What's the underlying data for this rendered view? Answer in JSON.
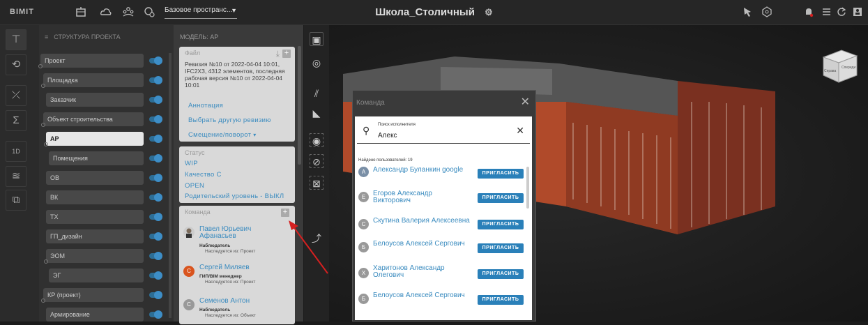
{
  "topbar": {
    "logo": "BIMIT",
    "icons": [
      "buildings-icon",
      "cloud-icon",
      "people-icon",
      "settings-gear-icon"
    ],
    "space_select": "Базовое пространс...",
    "project_title": "Школа_Столичный",
    "title_icon": "settings-gear-icon",
    "right_icons": [
      "cursor-icon",
      "rotate-icon",
      "bell-icon",
      "list-icon",
      "refresh-icon",
      "user-icon"
    ]
  },
  "toolstrip": {
    "tools": [
      "structure-tree-icon",
      "rotate-3d-icon",
      "merge-icon",
      "sum-icon",
      "cube-2d-icon",
      "layers-icon",
      "puzzle-icon"
    ]
  },
  "structure": {
    "header": "СТРУКТУРА ПРОЕКТА",
    "items": [
      {
        "label": "Проект"
      },
      {
        "label": "Площадка"
      },
      {
        "label": "Заказчик"
      },
      {
        "label": "Объект строительства"
      },
      {
        "label": "АР",
        "selected": true
      },
      {
        "label": "Помещения"
      },
      {
        "label": "ОВ"
      },
      {
        "label": "ВК"
      },
      {
        "label": "ТХ"
      },
      {
        "label": "ГП_дизайн"
      },
      {
        "label": "ЭОМ"
      },
      {
        "label": "ЭГ"
      },
      {
        "label": "КР (проект)"
      },
      {
        "label": "Армирование"
      }
    ]
  },
  "model": {
    "header": "МОДЕЛЬ: АР",
    "file": {
      "title": "Файл",
      "description": "Ревизия №10 от 2022-04-04 10:01, IFC2X3, 4312 элементов, последняя рабочая версия №10 от 2022-04-04 10:01",
      "annotation": "Аннотация",
      "choose_revision": "Выбрать другую ревизию",
      "offset": "Смещение/поворот"
    },
    "status": {
      "title": "Статус",
      "values": [
        "WIP",
        "Качество С",
        "OPEN",
        "Родительский уровень - ВЫКЛ"
      ]
    },
    "team": {
      "title": "Команда",
      "members": [
        {
          "name": "Павел Юрьевич Афанасьев",
          "role": "Наблюдатель",
          "inherit": "Наследуется из: Проект",
          "avatar": "photo",
          "color": "#cccccc"
        },
        {
          "name": "Сергей Миляев",
          "role": "ГИП/BIM менеджер",
          "inherit": "Наследуется из: Проект",
          "avatar": "С",
          "color": "#d9541e"
        },
        {
          "name": "Семенов Антон",
          "role": "Наблюдатель",
          "inherit": "Наследуется из: Объект",
          "avatar": "С",
          "color": "#999999"
        }
      ]
    }
  },
  "dialog": {
    "title": "Команда",
    "search_label": "Поиск исполнителя",
    "search_value": "Алекс",
    "found": "Найдено пользователей: 19",
    "invite_label": "ПРИГЛАСИТЬ",
    "users": [
      {
        "name": "Александр Буланкин google",
        "initial": "А",
        "color": "#7a8fa6"
      },
      {
        "name": "Егоров Александр Викторович",
        "initial": "Е",
        "color": "#b0b0b0"
      },
      {
        "name": "Скутина Валерия Алексеевна",
        "initial": "С",
        "color": "#b0b0b0"
      },
      {
        "name": "Белоусов Алексей Сергович",
        "initial": "Б",
        "color": "#b0b0b0"
      },
      {
        "name": "Харитонов Александр Олегович",
        "initial": "Х",
        "color": "#b0b0b0"
      },
      {
        "name": "Белоусов Алексей Сергович",
        "initial": "Б",
        "color": "#b0b0b0"
      }
    ]
  },
  "viewcube": {
    "labels": [
      "Справа",
      "Спереди"
    ]
  },
  "colors": {
    "accent": "#2a80b9",
    "link": "#3a8bbf",
    "toggle": "#3d8ec7",
    "arrow": "#d62020"
  }
}
